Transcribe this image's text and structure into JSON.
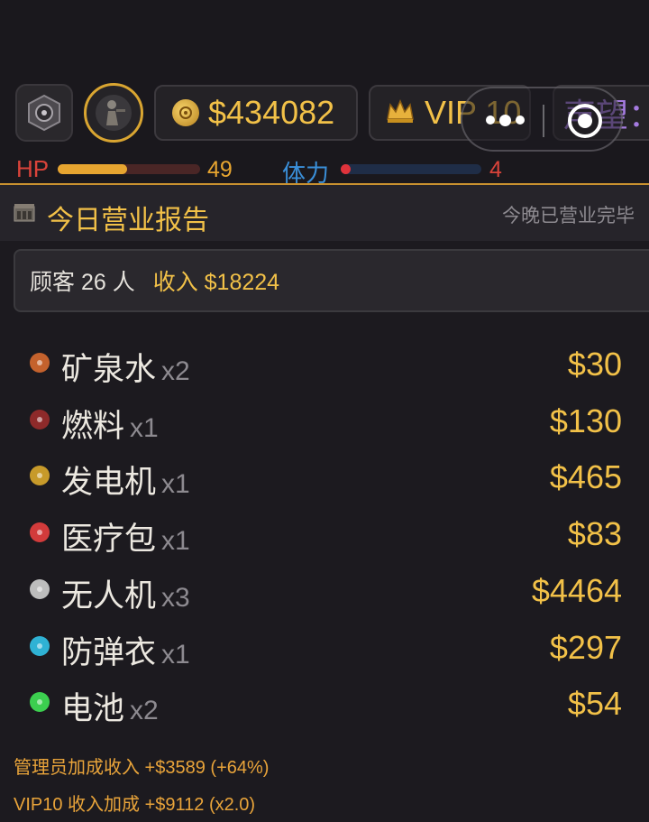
{
  "hud": {
    "money": "$434082",
    "vip": "VIP 10",
    "fame": "声望："
  },
  "stats": {
    "hp_label": "HP",
    "hp_value": "49",
    "hp_fraction": 0.49,
    "stamina_label": "体力",
    "stamina_value": "4",
    "stamina_fraction": 0.04
  },
  "report": {
    "title": "今日营业报告",
    "status": "今晚已营业完毕",
    "customers": "顾客 26 人",
    "income": "收入 $18224"
  },
  "items": [
    {
      "name": "矿泉水",
      "qty": "x2",
      "price": "$30",
      "icon": "water-icon",
      "color": "#c4622d"
    },
    {
      "name": "燃料",
      "qty": "x1",
      "price": "$130",
      "icon": "fuel-icon",
      "color": "#8e2a2a"
    },
    {
      "name": "发电机",
      "qty": "x1",
      "price": "$465",
      "icon": "generator-icon",
      "color": "#c79a2a"
    },
    {
      "name": "医疗包",
      "qty": "x1",
      "price": "$83",
      "icon": "medkit-icon",
      "color": "#d23b3b"
    },
    {
      "name": "无人机",
      "qty": "x3",
      "price": "$4464",
      "icon": "drone-icon",
      "color": "#bdbdbd"
    },
    {
      "name": "防弹衣",
      "qty": "x1",
      "price": "$297",
      "icon": "armor-icon",
      "color": "#2fb2d4"
    },
    {
      "name": "电池",
      "qty": "x2",
      "price": "$54",
      "icon": "battery-icon",
      "color": "#3ccf4f"
    }
  ],
  "bonuses": {
    "manager": "管理员加成收入 +$3589 (+64%)",
    "vip": "VIP10 收入加成 +$9112 (x2.0)"
  }
}
